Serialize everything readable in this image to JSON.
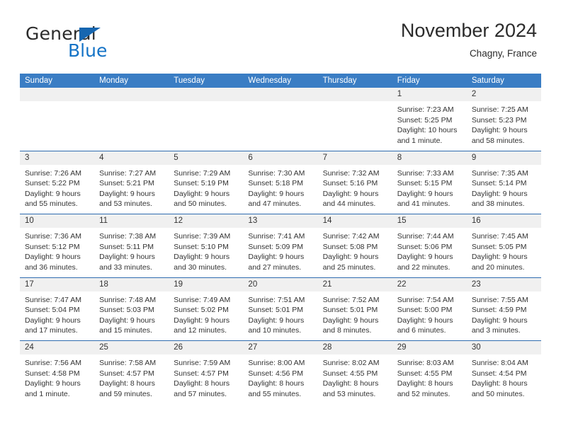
{
  "logo": {
    "word1": "General",
    "word2": "Blue",
    "triangle_color": "#1666b0",
    "blue_color": "#1473c6"
  },
  "header": {
    "title": "November 2024",
    "subtitle": "Chagny, France"
  },
  "calendar": {
    "accent_color": "#3a7dc4",
    "day_band_color": "#f0f0f0",
    "weekdays": [
      "Sunday",
      "Monday",
      "Tuesday",
      "Wednesday",
      "Thursday",
      "Friday",
      "Saturday"
    ],
    "weeks": [
      [
        {
          "day": "",
          "sunrise": "",
          "sunset": "",
          "daylight": "",
          "daylight2": ""
        },
        {
          "day": "",
          "sunrise": "",
          "sunset": "",
          "daylight": "",
          "daylight2": ""
        },
        {
          "day": "",
          "sunrise": "",
          "sunset": "",
          "daylight": "",
          "daylight2": ""
        },
        {
          "day": "",
          "sunrise": "",
          "sunset": "",
          "daylight": "",
          "daylight2": ""
        },
        {
          "day": "",
          "sunrise": "",
          "sunset": "",
          "daylight": "",
          "daylight2": ""
        },
        {
          "day": "1",
          "sunrise": "Sunrise: 7:23 AM",
          "sunset": "Sunset: 5:25 PM",
          "daylight": "Daylight: 10 hours",
          "daylight2": "and 1 minute."
        },
        {
          "day": "2",
          "sunrise": "Sunrise: 7:25 AM",
          "sunset": "Sunset: 5:23 PM",
          "daylight": "Daylight: 9 hours",
          "daylight2": "and 58 minutes."
        }
      ],
      [
        {
          "day": "3",
          "sunrise": "Sunrise: 7:26 AM",
          "sunset": "Sunset: 5:22 PM",
          "daylight": "Daylight: 9 hours",
          "daylight2": "and 55 minutes."
        },
        {
          "day": "4",
          "sunrise": "Sunrise: 7:27 AM",
          "sunset": "Sunset: 5:21 PM",
          "daylight": "Daylight: 9 hours",
          "daylight2": "and 53 minutes."
        },
        {
          "day": "5",
          "sunrise": "Sunrise: 7:29 AM",
          "sunset": "Sunset: 5:19 PM",
          "daylight": "Daylight: 9 hours",
          "daylight2": "and 50 minutes."
        },
        {
          "day": "6",
          "sunrise": "Sunrise: 7:30 AM",
          "sunset": "Sunset: 5:18 PM",
          "daylight": "Daylight: 9 hours",
          "daylight2": "and 47 minutes."
        },
        {
          "day": "7",
          "sunrise": "Sunrise: 7:32 AM",
          "sunset": "Sunset: 5:16 PM",
          "daylight": "Daylight: 9 hours",
          "daylight2": "and 44 minutes."
        },
        {
          "day": "8",
          "sunrise": "Sunrise: 7:33 AM",
          "sunset": "Sunset: 5:15 PM",
          "daylight": "Daylight: 9 hours",
          "daylight2": "and 41 minutes."
        },
        {
          "day": "9",
          "sunrise": "Sunrise: 7:35 AM",
          "sunset": "Sunset: 5:14 PM",
          "daylight": "Daylight: 9 hours",
          "daylight2": "and 38 minutes."
        }
      ],
      [
        {
          "day": "10",
          "sunrise": "Sunrise: 7:36 AM",
          "sunset": "Sunset: 5:12 PM",
          "daylight": "Daylight: 9 hours",
          "daylight2": "and 36 minutes."
        },
        {
          "day": "11",
          "sunrise": "Sunrise: 7:38 AM",
          "sunset": "Sunset: 5:11 PM",
          "daylight": "Daylight: 9 hours",
          "daylight2": "and 33 minutes."
        },
        {
          "day": "12",
          "sunrise": "Sunrise: 7:39 AM",
          "sunset": "Sunset: 5:10 PM",
          "daylight": "Daylight: 9 hours",
          "daylight2": "and 30 minutes."
        },
        {
          "day": "13",
          "sunrise": "Sunrise: 7:41 AM",
          "sunset": "Sunset: 5:09 PM",
          "daylight": "Daylight: 9 hours",
          "daylight2": "and 27 minutes."
        },
        {
          "day": "14",
          "sunrise": "Sunrise: 7:42 AM",
          "sunset": "Sunset: 5:08 PM",
          "daylight": "Daylight: 9 hours",
          "daylight2": "and 25 minutes."
        },
        {
          "day": "15",
          "sunrise": "Sunrise: 7:44 AM",
          "sunset": "Sunset: 5:06 PM",
          "daylight": "Daylight: 9 hours",
          "daylight2": "and 22 minutes."
        },
        {
          "day": "16",
          "sunrise": "Sunrise: 7:45 AM",
          "sunset": "Sunset: 5:05 PM",
          "daylight": "Daylight: 9 hours",
          "daylight2": "and 20 minutes."
        }
      ],
      [
        {
          "day": "17",
          "sunrise": "Sunrise: 7:47 AM",
          "sunset": "Sunset: 5:04 PM",
          "daylight": "Daylight: 9 hours",
          "daylight2": "and 17 minutes."
        },
        {
          "day": "18",
          "sunrise": "Sunrise: 7:48 AM",
          "sunset": "Sunset: 5:03 PM",
          "daylight": "Daylight: 9 hours",
          "daylight2": "and 15 minutes."
        },
        {
          "day": "19",
          "sunrise": "Sunrise: 7:49 AM",
          "sunset": "Sunset: 5:02 PM",
          "daylight": "Daylight: 9 hours",
          "daylight2": "and 12 minutes."
        },
        {
          "day": "20",
          "sunrise": "Sunrise: 7:51 AM",
          "sunset": "Sunset: 5:01 PM",
          "daylight": "Daylight: 9 hours",
          "daylight2": "and 10 minutes."
        },
        {
          "day": "21",
          "sunrise": "Sunrise: 7:52 AM",
          "sunset": "Sunset: 5:01 PM",
          "daylight": "Daylight: 9 hours",
          "daylight2": "and 8 minutes."
        },
        {
          "day": "22",
          "sunrise": "Sunrise: 7:54 AM",
          "sunset": "Sunset: 5:00 PM",
          "daylight": "Daylight: 9 hours",
          "daylight2": "and 6 minutes."
        },
        {
          "day": "23",
          "sunrise": "Sunrise: 7:55 AM",
          "sunset": "Sunset: 4:59 PM",
          "daylight": "Daylight: 9 hours",
          "daylight2": "and 3 minutes."
        }
      ],
      [
        {
          "day": "24",
          "sunrise": "Sunrise: 7:56 AM",
          "sunset": "Sunset: 4:58 PM",
          "daylight": "Daylight: 9 hours",
          "daylight2": "and 1 minute."
        },
        {
          "day": "25",
          "sunrise": "Sunrise: 7:58 AM",
          "sunset": "Sunset: 4:57 PM",
          "daylight": "Daylight: 8 hours",
          "daylight2": "and 59 minutes."
        },
        {
          "day": "26",
          "sunrise": "Sunrise: 7:59 AM",
          "sunset": "Sunset: 4:57 PM",
          "daylight": "Daylight: 8 hours",
          "daylight2": "and 57 minutes."
        },
        {
          "day": "27",
          "sunrise": "Sunrise: 8:00 AM",
          "sunset": "Sunset: 4:56 PM",
          "daylight": "Daylight: 8 hours",
          "daylight2": "and 55 minutes."
        },
        {
          "day": "28",
          "sunrise": "Sunrise: 8:02 AM",
          "sunset": "Sunset: 4:55 PM",
          "daylight": "Daylight: 8 hours",
          "daylight2": "and 53 minutes."
        },
        {
          "day": "29",
          "sunrise": "Sunrise: 8:03 AM",
          "sunset": "Sunset: 4:55 PM",
          "daylight": "Daylight: 8 hours",
          "daylight2": "and 52 minutes."
        },
        {
          "day": "30",
          "sunrise": "Sunrise: 8:04 AM",
          "sunset": "Sunset: 4:54 PM",
          "daylight": "Daylight: 8 hours",
          "daylight2": "and 50 minutes."
        }
      ]
    ]
  }
}
